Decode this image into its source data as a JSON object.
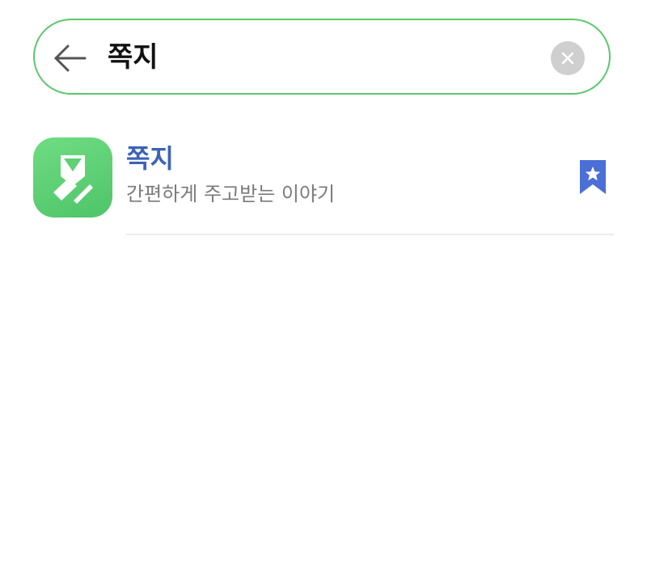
{
  "search": {
    "query": "쪽지",
    "back_icon": "arrow-left-icon",
    "clear_icon": "close-icon",
    "border_color": "#5bc76b"
  },
  "results": [
    {
      "name": "쪽지",
      "description": "간편하게 주고받는 이야기",
      "icon": "app-icon",
      "bookmark_icon": "bookmark-star-icon",
      "name_color": "#3b63b6",
      "icon_color": "#5fd075",
      "bookmark_color": "#4a6fd6"
    }
  ]
}
